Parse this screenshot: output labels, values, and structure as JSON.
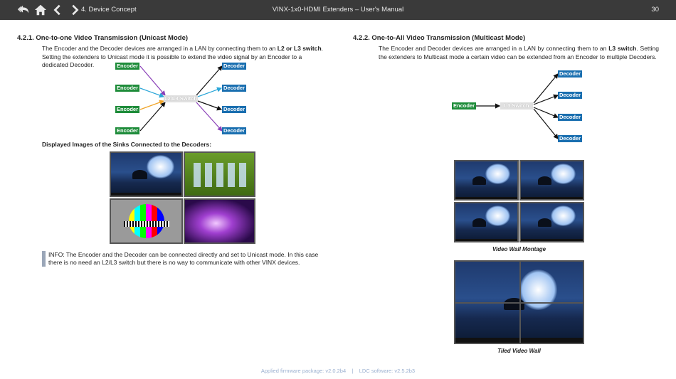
{
  "header": {
    "section": "4. Device Concept",
    "title": "VINX-1x0-HDMI Extenders – User's Manual",
    "page": "30",
    "nav_icons": [
      "back-icon",
      "home-icon",
      "previous-icon",
      "next-icon"
    ]
  },
  "left": {
    "heading": "4.2.1. One-to-one Video Transmission (Unicast Mode)",
    "para_a": "The Encoder and the Decoder devices are arranged in a LAN by connecting them to an ",
    "para_bold": "L2 or L3 switch",
    "para_b": ". Setting the extenders to Unicast mode it is possible to extend the video signal by an Encoder to a dedicated Decoder.",
    "diagram": {
      "encoder_label": "Encoder",
      "decoder_label": "Decoder",
      "switch_label": "L2/L3 Switch",
      "arrow_colors": [
        "#8a3fb8",
        "#2aa6d8",
        "#f0a428",
        "#111111"
      ]
    },
    "sinks_heading": "Displayed Images of the Sinks Connected to the Decoders:",
    "info": "INFO: The Encoder and the Decoder can be connected directly and set to Unicast mode. In this case there is no need an L2/L3 switch but there is no way to communicate with other VINX devices."
  },
  "right": {
    "heading": "4.2.2. One-to-All Video Transmission (Multicast Mode)",
    "para_a": "The Encoder and Decoder devices are arranged in a LAN by connecting them to an ",
    "para_bold": "L3 switch",
    "para_b": ". Setting the extenders to Multicast mode a certain video can be extended from an Encoder to multiple Decoders.",
    "diagram": {
      "encoder_label": "Encoder",
      "decoder_label": "Decoder",
      "switch_label": "L3 Switch"
    },
    "caption_montage": "Video Wall Montage",
    "caption_tiled": "Tiled Video Wall"
  },
  "footer": "Applied firmware package: v2.0.2b4    |    LDC software: v2.5.2b3",
  "colors": {
    "encoder": "#1e8c3a",
    "decoder": "#1a6fb0",
    "header_bg": "#3a3a3a",
    "footer_text": "#9bb0d0"
  }
}
